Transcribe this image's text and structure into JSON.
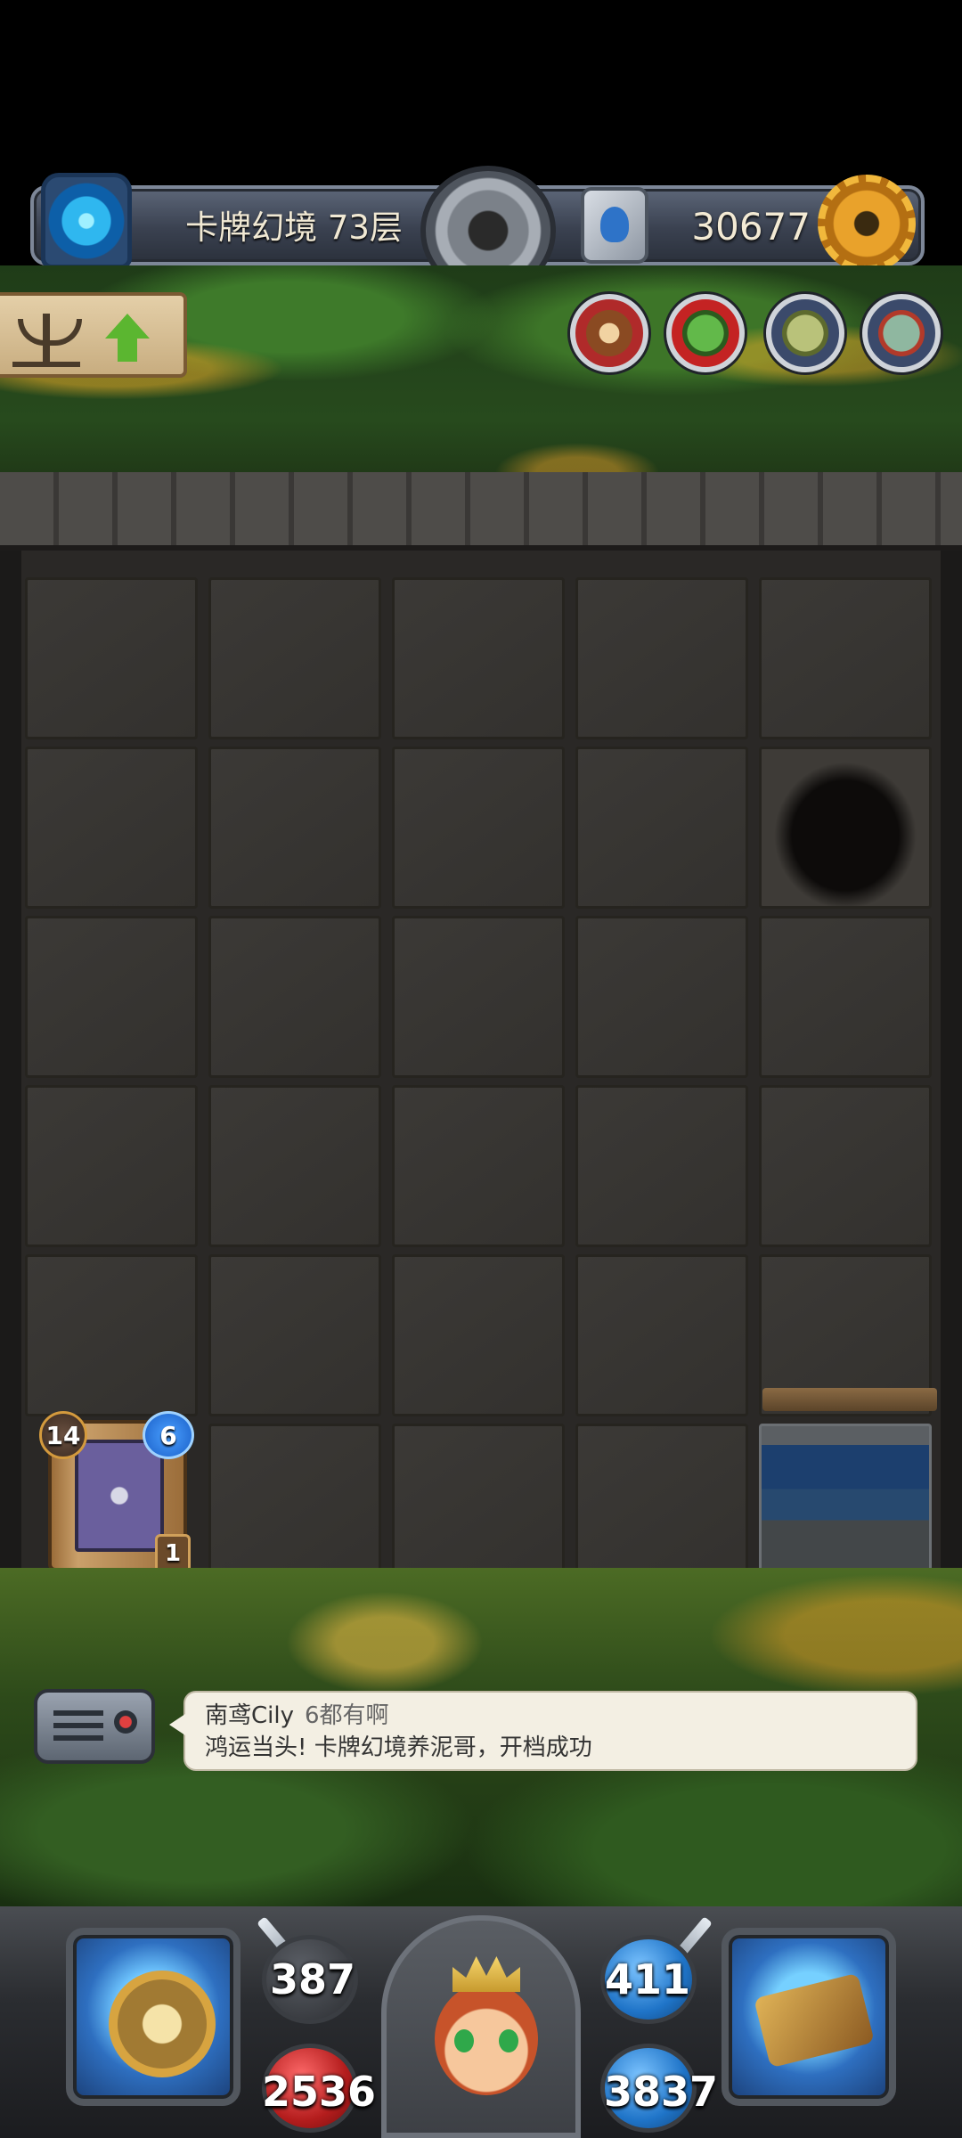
{
  "header": {
    "floor_label": "卡牌幻境 73层",
    "coins": "30677",
    "icons": [
      "portal-icon",
      "bomb-icon",
      "rune-icon",
      "gear-icon"
    ]
  },
  "status_effects": [
    "meat-icon",
    "goblin-icon",
    "zombie-icon",
    "mummy-icon"
  ],
  "upgrade_panel": {
    "icons": [
      "candelabra-icon",
      "arrow-up-icon"
    ]
  },
  "card": {
    "level": "14",
    "mana": "6",
    "count": "1"
  },
  "chat": {
    "user": "南鸢Cily",
    "message": "6都有啊",
    "system": "鸿运当头! 卡牌幻境养泥哥，开档成功"
  },
  "stats": {
    "attack": "387",
    "hp": "2536",
    "defense": "411",
    "mana": "3837"
  },
  "colors": {
    "accent_gold": "#e9a22b",
    "board_tile": "#3b3936",
    "hp_red": "#b41d1d",
    "mana_blue": "#1f74c8"
  }
}
